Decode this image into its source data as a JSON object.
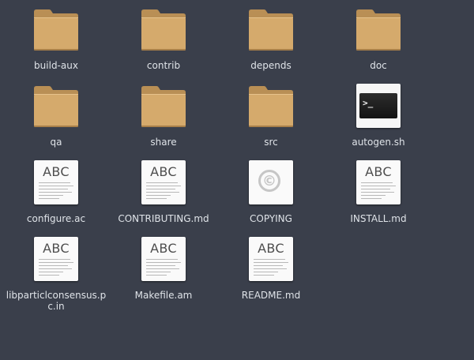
{
  "files": [
    {
      "name": "build-aux",
      "type": "folder",
      "icon": "folder-icon"
    },
    {
      "name": "contrib",
      "type": "folder",
      "icon": "folder-icon"
    },
    {
      "name": "depends",
      "type": "folder",
      "icon": "folder-icon"
    },
    {
      "name": "doc",
      "type": "folder",
      "icon": "folder-icon"
    },
    {
      "name": "qa",
      "type": "folder",
      "icon": "folder-icon"
    },
    {
      "name": "share",
      "type": "folder",
      "icon": "folder-icon"
    },
    {
      "name": "src",
      "type": "folder",
      "icon": "folder-icon"
    },
    {
      "name": "autogen.sh",
      "type": "script",
      "icon": "terminal-script-icon",
      "glyph": ">_"
    },
    {
      "name": "configure.ac",
      "type": "text",
      "icon": "text-document-icon",
      "glyph": "ABC"
    },
    {
      "name": "CONTRIBUTING.md",
      "type": "text",
      "icon": "text-document-icon",
      "glyph": "ABC"
    },
    {
      "name": "COPYING",
      "type": "license",
      "icon": "copyright-document-icon",
      "glyph": "©"
    },
    {
      "name": "INSTALL.md",
      "type": "text",
      "icon": "text-document-icon",
      "glyph": "ABC"
    },
    {
      "name": "libparticlconsensus.pc.in",
      "type": "text",
      "icon": "text-document-icon",
      "glyph": "ABC"
    },
    {
      "name": "Makefile.am",
      "type": "text",
      "icon": "text-document-icon",
      "glyph": "ABC"
    },
    {
      "name": "README.md",
      "type": "text",
      "icon": "text-document-icon",
      "glyph": "ABC"
    }
  ],
  "colors": {
    "background": "#3a3f4b",
    "folder": "#d4a86a",
    "label": "#dfe3e8"
  }
}
